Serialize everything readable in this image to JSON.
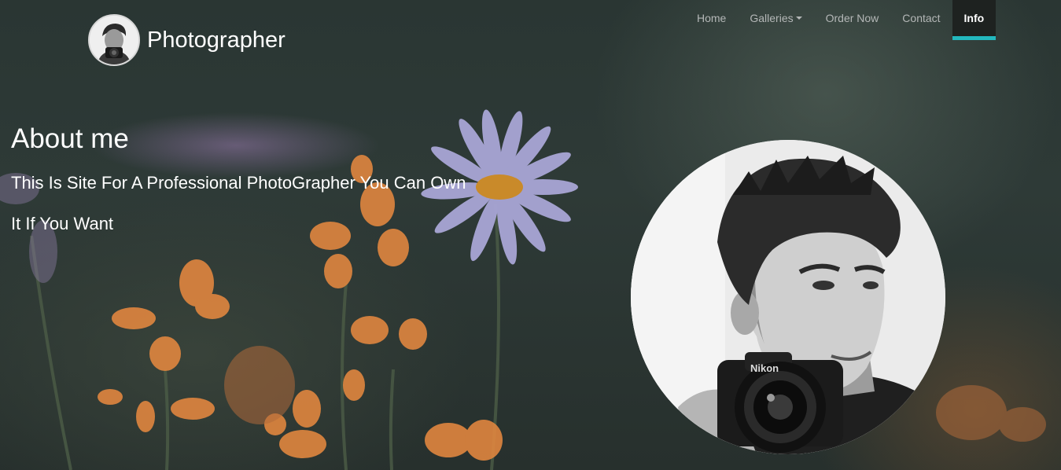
{
  "brand": {
    "title": "Photographer",
    "logo_icon": "photographer-avatar-icon"
  },
  "nav": {
    "items": [
      {
        "label": "Home",
        "active": false
      },
      {
        "label": "Galleries",
        "active": false,
        "has_dropdown": true
      },
      {
        "label": "Order Now",
        "active": false
      },
      {
        "label": "Contact",
        "active": false
      },
      {
        "label": "Info",
        "active": true
      }
    ],
    "active_indicator_color": "#23b7bd"
  },
  "about": {
    "heading": "About me",
    "line1": "This Is Site For A Professional PhotoGrapher You Can Own",
    "line2": "It If You Want"
  },
  "portrait": {
    "icon": "photographer-portrait-icon"
  }
}
